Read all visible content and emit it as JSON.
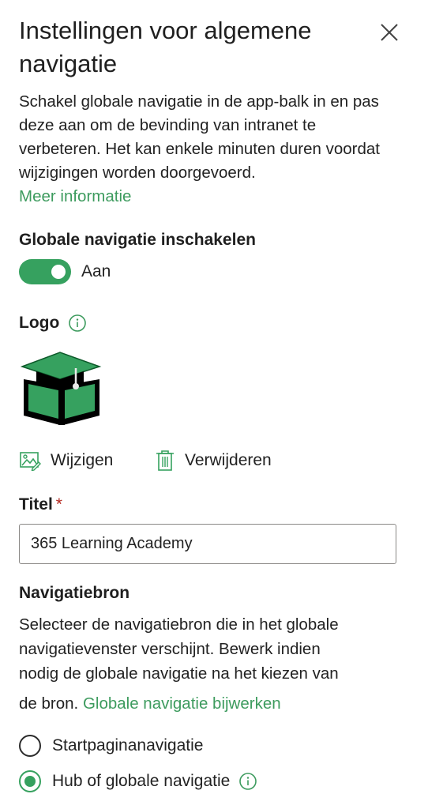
{
  "panel": {
    "title": "Instellingen voor algemene navigatie",
    "description": "Schakel globale navigatie in de app-balk in en pas deze aan om de bevinding van intranet te verbeteren. Het kan enkele minuten duren voordat wijzigingen worden doorgevoerd.",
    "more_info_link": "Meer informatie"
  },
  "global_nav": {
    "label": "Globale navigatie inschakelen",
    "toggle_state": "Aan",
    "enabled": true
  },
  "logo": {
    "label": "Logo",
    "change_label": "Wijzigen",
    "remove_label": "Verwijderen"
  },
  "title_field": {
    "label": "Titel",
    "required_marker": "*",
    "value": "365 Learning Academy"
  },
  "nav_source": {
    "label": "Navigatiebron",
    "description_lines": [
      "Selecteer de navigatiebron die in het globale",
      "navigatievenster verschijnt. Bewerk indien",
      "nodig de globale navigatie na het kiezen van"
    ],
    "description_last": "de bron.",
    "edit_link": "Globale navigatie bijwerken",
    "options": [
      {
        "label": "Startpaginanavigatie",
        "selected": false
      },
      {
        "label": "Hub of globale navigatie",
        "selected": true
      }
    ]
  },
  "colors": {
    "accent": "#36a15f",
    "link": "#3d9b5e",
    "required": "#b3261e"
  },
  "icons": {
    "close": "close-icon",
    "info": "info-icon",
    "change": "image-edit-icon",
    "remove": "trash-icon",
    "logo": "graduation-cap-book-logo"
  }
}
